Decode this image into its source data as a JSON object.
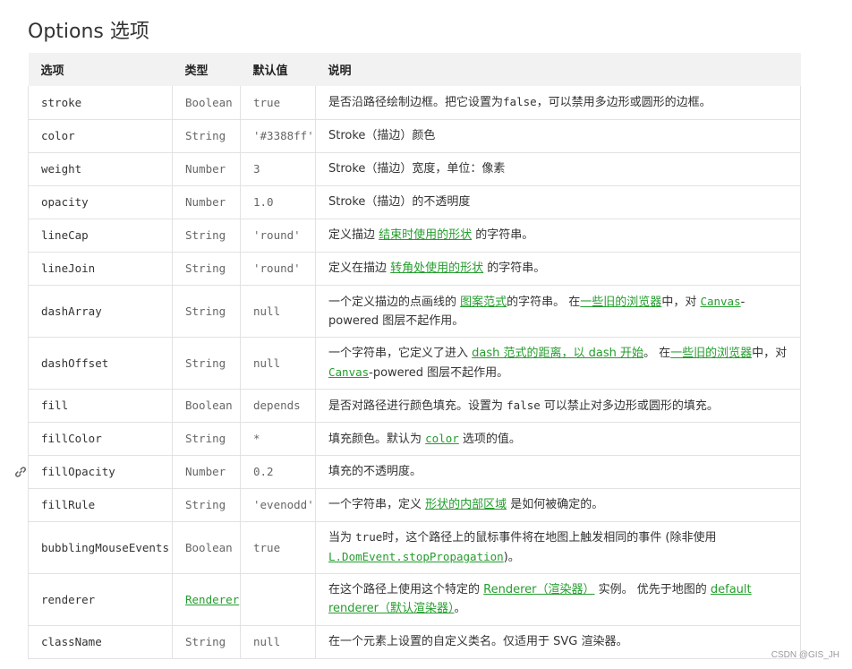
{
  "heading": "Options 选项",
  "table": {
    "headers": [
      "选项",
      "类型",
      "默认值",
      "说明"
    ],
    "rows": [
      {
        "option": "stroke",
        "type": "Boolean",
        "default": "true",
        "desc": [
          {
            "t": "是否沿路径绘制边框。把它设置为"
          },
          {
            "t": "false",
            "code": true
          },
          {
            "t": "，可以禁用多边形或圆形的边框。"
          }
        ]
      },
      {
        "option": "color",
        "type": "String",
        "default": "'#3388ff'",
        "desc": [
          {
            "t": "Stroke（描边）颜色"
          }
        ]
      },
      {
        "option": "weight",
        "type": "Number",
        "default": "3",
        "desc": [
          {
            "t": "Stroke（描边）宽度，单位：像素"
          }
        ]
      },
      {
        "option": "opacity",
        "type": "Number",
        "default": "1.0",
        "desc": [
          {
            "t": "Stroke（描边）的不透明度"
          }
        ]
      },
      {
        "option": "lineCap",
        "type": "String",
        "default": "'round'",
        "desc": [
          {
            "t": "定义描边 "
          },
          {
            "t": "结束时使用的形状",
            "link": true
          },
          {
            "t": " 的字符串。"
          }
        ]
      },
      {
        "option": "lineJoin",
        "type": "String",
        "default": "'round'",
        "desc": [
          {
            "t": "定义在描边 "
          },
          {
            "t": "转角处使用的形状",
            "link": true
          },
          {
            "t": " 的字符串。"
          }
        ]
      },
      {
        "option": "dashArray",
        "type": "String",
        "default": "null",
        "desc": [
          {
            "t": "一个定义描边的点画线的 "
          },
          {
            "t": "图案范式",
            "link": true
          },
          {
            "t": "的字符串。 在"
          },
          {
            "t": "一些旧的浏览器",
            "link": true
          },
          {
            "t": "中，对 "
          },
          {
            "t": "Canvas",
            "link": true,
            "code": true
          },
          {
            "t": "-powered 图层不起作用。"
          }
        ]
      },
      {
        "option": "dashOffset",
        "type": "String",
        "default": "null",
        "desc": [
          {
            "t": "一个字符串，它定义了进入 "
          },
          {
            "t": "dash 范式的距离，以 dash 开始",
            "link": true
          },
          {
            "t": "。 在"
          },
          {
            "t": "一些旧的浏览器",
            "link": true
          },
          {
            "t": "中，对 "
          },
          {
            "t": "Canvas",
            "link": true,
            "code": true
          },
          {
            "t": "-powered 图层不起作用。"
          }
        ]
      },
      {
        "option": "fill",
        "type": "Boolean",
        "default": "depends",
        "desc": [
          {
            "t": "是否对路径进行颜色填充。设置为 "
          },
          {
            "t": "false",
            "code": true
          },
          {
            "t": " 可以禁止对多边形或圆形的填充。"
          }
        ]
      },
      {
        "option": "fillColor",
        "type": "String",
        "default": "*",
        "desc": [
          {
            "t": "填充颜色。默认为 "
          },
          {
            "t": "color",
            "link": true,
            "code": true
          },
          {
            "t": " 选项的值。"
          }
        ]
      },
      {
        "option": "fillOpacity",
        "type": "Number",
        "default": "0.2",
        "desc": [
          {
            "t": "填充的不透明度。"
          }
        ]
      },
      {
        "option": "fillRule",
        "type": "String",
        "default": "'evenodd'",
        "desc": [
          {
            "t": "一个字符串，定义 "
          },
          {
            "t": "形状的内部区域",
            "link": true
          },
          {
            "t": " 是如何被确定的。"
          }
        ]
      },
      {
        "option": "bubblingMouseEvents",
        "type": "Boolean",
        "default": "true",
        "desc": [
          {
            "t": "当为 "
          },
          {
            "t": "true",
            "code": true
          },
          {
            "t": "时，这个路径上的鼠标事件将在地图上触发相同的事件 (除非使用 "
          },
          {
            "t": "L.DomEvent.stopPropagation",
            "link": true,
            "code": true
          },
          {
            "t": ")。"
          }
        ]
      },
      {
        "option": "renderer",
        "type": "Renderer",
        "type_link": true,
        "default": "",
        "desc": [
          {
            "t": "在这个路径上使用这个特定的 "
          },
          {
            "t": "Renderer（渲染器）",
            "link": true
          },
          {
            "t": " 实例。 优先于地图的 "
          },
          {
            "t": "default renderer（默认渲染器）",
            "link": true
          },
          {
            "t": "。"
          }
        ]
      },
      {
        "option": "className",
        "type": "String",
        "default": "null",
        "desc": [
          {
            "t": "在一个元素上设置的自定义类名。仅适用于 SVG 渲染器。"
          }
        ]
      }
    ],
    "row_heights": [
      37,
      37,
      37,
      37,
      37,
      37,
      58,
      58,
      37,
      37,
      37,
      37,
      58,
      58,
      37
    ]
  },
  "watermark": "CSDN @GIS_JH",
  "colors": {
    "link": "#249d2d",
    "header_bg": "#f2f2f2",
    "border": "#e2e2e2"
  },
  "icons": {
    "row_anchor": "link-icon"
  }
}
